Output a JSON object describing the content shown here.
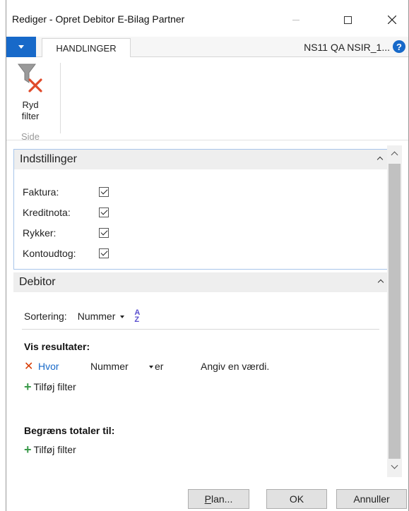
{
  "window": {
    "title": "Rediger - Opret Debitor E-Bilag Partner"
  },
  "ribbon": {
    "tab_active": "HANDLINGER",
    "company": "NS11 QA NSIR_1...",
    "help_icon": "?",
    "clear_filter_label_line1": "Ryd",
    "clear_filter_label_line2": "filter",
    "group_label": "Side"
  },
  "indstillinger": {
    "header": "Indstillinger",
    "fields": [
      {
        "label": "Faktura:",
        "checked": true
      },
      {
        "label": "Kreditnota:",
        "checked": true
      },
      {
        "label": "Rykker:",
        "checked": true
      },
      {
        "label": "Kontoudtog:",
        "checked": true
      }
    ]
  },
  "debitor": {
    "header": "Debitor",
    "sort_label": "Sortering:",
    "sort_value": "Nummer",
    "sort_icon_top": "A",
    "sort_icon_bottom": "Z",
    "results_title": "Vis resultater:",
    "filter": {
      "where": "Hvor",
      "field": "Nummer",
      "operator": "er",
      "value_placeholder": "Angiv en værdi."
    },
    "add_filter_label": "Tilføj filter",
    "limit_totals_title": "Begræns totaler til:",
    "add_filter_label_2": "Tilføj filter"
  },
  "footer": {
    "plan_label_first": "P",
    "plan_label_rest": "lan...",
    "ok_label": "OK",
    "cancel_label": "Annuller"
  },
  "colors": {
    "accent": "#1769c9",
    "remove": "#d83b01",
    "add": "#3a9a4a"
  }
}
